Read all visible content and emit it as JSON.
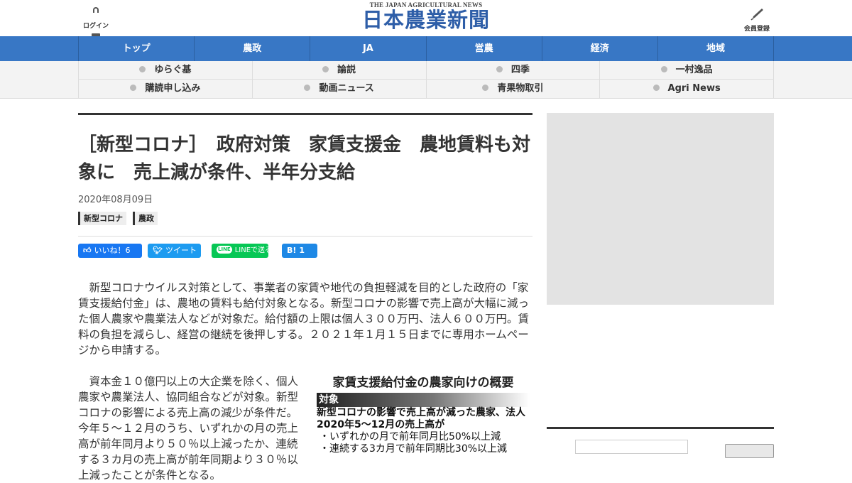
{
  "header": {
    "login_label": "ログイン",
    "signup_label": "会員登録",
    "logo_en": "THE JAPAN AGRICULTURAL NEWS",
    "logo_jp": "日本農業新聞"
  },
  "main_nav": [
    "トップ",
    "農政",
    "JA",
    "営農",
    "経済",
    "地域"
  ],
  "sub_nav": [
    "ゆらぐ基",
    "論説",
    "四季",
    "一村逸品",
    "購読申し込み",
    "動画ニュース",
    "青果物取引",
    "Agri News"
  ],
  "article": {
    "title": "［新型コロナ］　政府対策　家賃支援金　農地賃料も対象に　売上減が条件、半年分支給",
    "date": "2020年08月09日",
    "tags": [
      "新型コロナ",
      "農政"
    ],
    "share": {
      "facebook": "いいね！6",
      "twitter": "ツイート",
      "line": "LINEで送る",
      "hatena_count": "1"
    },
    "paragraph1": "　新型コロナウイルス対策として、事業者の家賃や地代の負担軽減を目的とした政府の「家賃支援給付金」は、農地の賃料も給付対象となる。新型コロナの影響で売上高が大幅に減った個人農家や農業法人などが対象だ。給付額の上限は個人３００万円、法人６００万円。賃料の負担を減らし、経営の継続を後押しする。２０２１年１月１５日までに専用ホームページから申請する。",
    "paragraph2": "　資本金１０億円以上の大企業を除く、個人農家や農業法人、協同組合などが対象。新型コロナの影響による売上高の減少が条件だ。今年５～１２月のうち、いずれかの月の売上高が前年同月より５０％以上減ったか、連続する３カ月の売上高が前年同期より３０％以上減ったことが条件となる。"
  },
  "figure": {
    "title": "家賃支援給付金の農家向けの概要",
    "band": "対象",
    "line1": "新型コロナの影響で売上高が減った農家、法人",
    "line2": "2020年5〜12月の売上高が",
    "bullet1": "・いずれかの月で前年同月比50%以上減",
    "bullet2": "・連続する3カ月で前年同期比30%以上減"
  },
  "colors": {
    "nav_blue": "#3877c5",
    "logo_blue": "#2e5ea8",
    "facebook": "#1877f2",
    "twitter": "#1d9bf0",
    "line": "#06c755",
    "hatena": "#1e88e5"
  }
}
